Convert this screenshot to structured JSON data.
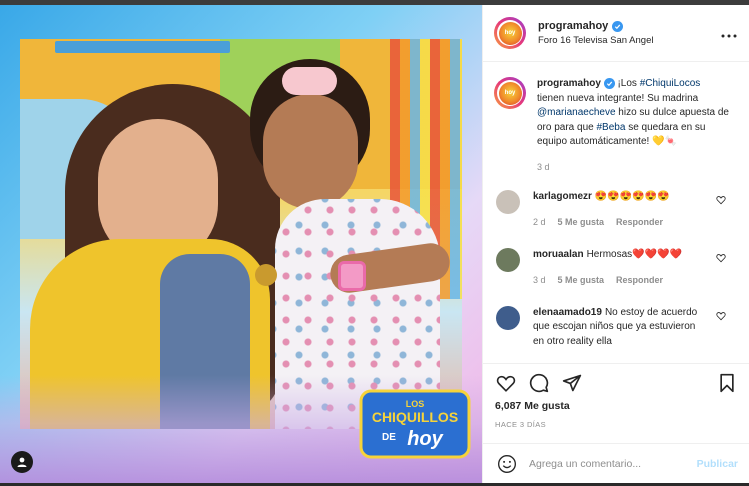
{
  "post": {
    "username": "programahoy",
    "location": "Foro 16 Televisa San Angel",
    "avatar_text": "hoy",
    "caption": {
      "username": "programahoy",
      "parts": [
        {
          "text": "¡Los ",
          "link": false
        },
        {
          "text": "#ChiquiLocos",
          "link": true
        },
        {
          "text": " tienen nueva integrante! Su madrina ",
          "link": false
        },
        {
          "text": "@marianaecheve",
          "link": true
        },
        {
          "text": " hizo su dulce apuesta de oro para que ",
          "link": false
        },
        {
          "text": "#Beba",
          "link": true
        },
        {
          "text": " se quedara en su equipo automáticamente! 💛🍬",
          "link": false
        }
      ],
      "time": "3 d"
    },
    "comments": [
      {
        "username": "karlagomezr",
        "text": "😍😍😍😍😍😍",
        "time": "2 d",
        "likes": "5 Me gusta",
        "reply": "Responder",
        "avatar_color": "#c9c1b8"
      },
      {
        "username": "moruaalan",
        "text": "Hermosas❤️❤️❤️❤️",
        "time": "3 d",
        "likes": "5 Me gusta",
        "reply": "Responder",
        "avatar_color": "#6d7a5e"
      },
      {
        "username": "elenaamado19",
        "text": "No estoy de acuerdo que escojan niños que ya estuvieron en otro reality ella",
        "time": "",
        "likes": "",
        "reply": "",
        "avatar_color": "#3f5d8c"
      }
    ],
    "likes": "6,087 Me gusta",
    "ago": "HACE 3 DÍAS",
    "comment_placeholder": "Agrega un comentario...",
    "publish_label": "Publicar",
    "logo_lines": [
      "LOS",
      "CHIQUILLOS",
      "DE",
      "hoy"
    ]
  },
  "colors": {
    "link": "#00376b",
    "verified": "#3897f0",
    "publish_disabled": "#b2dffc",
    "text": "#262626",
    "secondary": "#8e8e8e"
  },
  "icons": [
    "more-options-icon",
    "verified-icon",
    "like-heart-icon",
    "comment-icon",
    "share-icon",
    "save-bookmark-icon",
    "emoji-icon",
    "comment-like-icon",
    "user-tag-icon"
  ]
}
